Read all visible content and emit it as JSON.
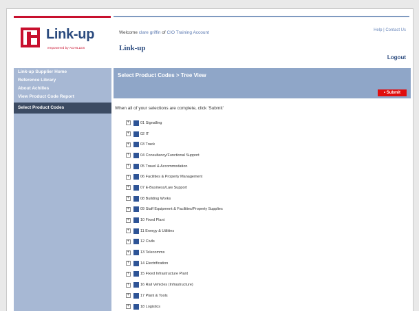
{
  "header": {
    "logo_text": "Link-up",
    "logo_sub": "empowered by ACHILLES",
    "welcome_prefix": "Welcome",
    "user_name": "clare griffin",
    "welcome_of": "of",
    "account_name": "CIO Training Account",
    "site_title": "Link-up",
    "help_link": "Help",
    "separator": "|",
    "contact_link": "Contact Us",
    "logout_label": "Logout"
  },
  "sidebar": {
    "items": [
      {
        "label": "Link-up Supplier Home"
      },
      {
        "label": "Reference Library"
      },
      {
        "label": "About Achilles"
      },
      {
        "label": "View Product Code Report"
      },
      {
        "label": "Select Product Codes"
      }
    ]
  },
  "main": {
    "title": "Select Product Codes > Tree View",
    "submit_label": "• Submit",
    "instruction": "When all of your selections are complete, click 'Submit'",
    "tree": [
      "01 Signalling",
      "02 IT",
      "03 Track",
      "04 Consultancy/Functional Support",
      "05 Travel & Accommodation",
      "06 Facilities & Property Management",
      "07 E-Business/Law Support",
      "08 Building Works",
      "09 Staff Equipment & Facilities/Property Supplies",
      "10 Fixed Plant",
      "11 Energy & Utilities",
      "12 Civils",
      "13 Telecomms",
      "14 Electrification",
      "15 Fixed Infrastructure Plant",
      "16 Rail Vehicles (Infrastructure)",
      "17 Plant & Tools",
      "18 Logistics"
    ]
  }
}
